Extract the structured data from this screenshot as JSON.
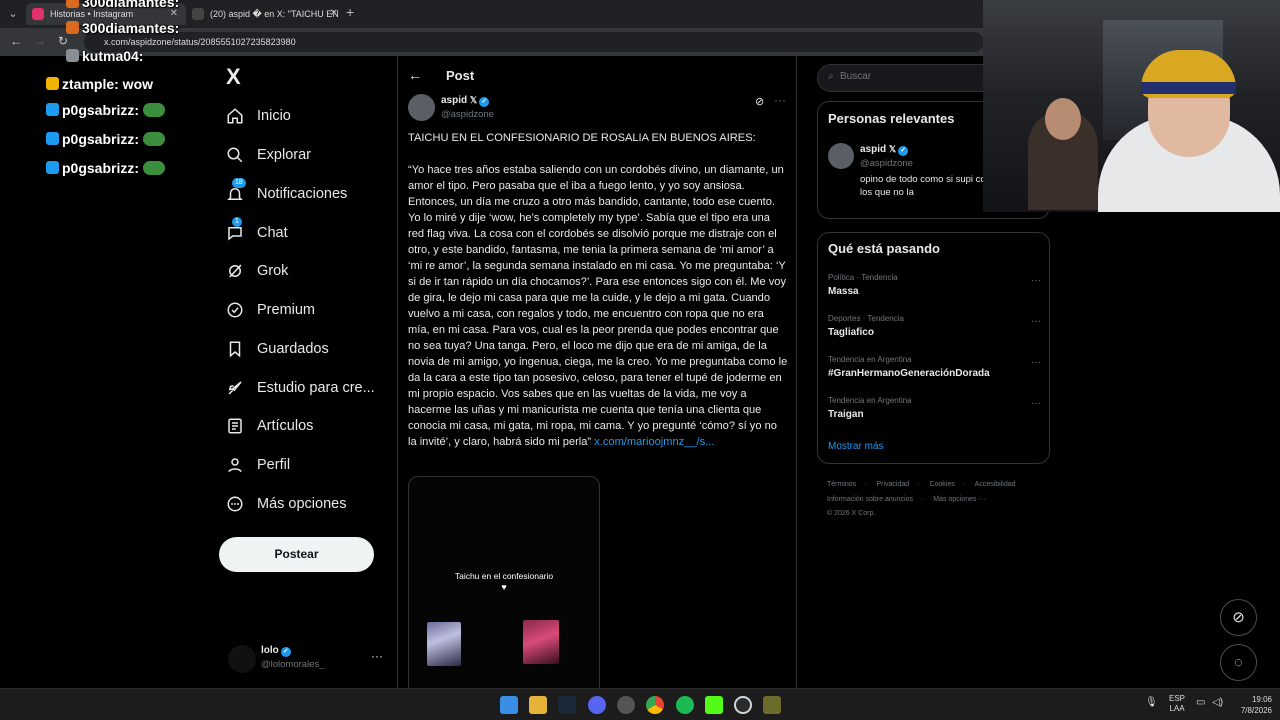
{
  "browser": {
    "tabs": [
      {
        "title": "Historias • Instagram",
        "color": "#e1306c"
      },
      {
        "title": "(20) aspid � en X: \"TAICHU EN",
        "color": "#000000"
      }
    ],
    "url": "x.com/aspidzone/status/2085551027235823980"
  },
  "stream_chat": [
    {
      "text": "300diamantes:",
      "badge": "#d96b1f",
      "emote": false
    },
    {
      "text": "kutma04:",
      "badge": "#8a8f95",
      "emote": false
    },
    {
      "text": "ztample: wow",
      "badge": "#f0b400",
      "emote": false
    },
    {
      "text": "p0gsabrizz:",
      "badge": "#1d9bf0",
      "emote": true
    },
    {
      "text": "p0gsabrizz:",
      "badge": "#1d9bf0",
      "emote": true
    },
    {
      "text": "p0gsabrizz:",
      "badge": "#1d9bf0",
      "emote": true
    }
  ],
  "nav": {
    "logo": "X",
    "items": [
      {
        "label": "Inicio",
        "icon": "home-icon"
      },
      {
        "label": "Explorar",
        "icon": "search-icon"
      },
      {
        "label": "Notificaciones",
        "icon": "bell-icon",
        "badge": "18"
      },
      {
        "label": "Chat",
        "icon": "chat-icon",
        "badge": "1"
      },
      {
        "label": "Grok",
        "icon": "grok-icon"
      },
      {
        "label": "Premium",
        "icon": "premium-icon"
      },
      {
        "label": "Guardados",
        "icon": "bookmark-icon"
      },
      {
        "label": "Estudio para cre...",
        "icon": "rocket-icon"
      },
      {
        "label": "Artículos",
        "icon": "article-icon"
      },
      {
        "label": "Perfil",
        "icon": "person-icon"
      },
      {
        "label": "Más opciones",
        "icon": "more-circle-icon"
      }
    ],
    "post_button": "Postear",
    "account": {
      "name": "lolo",
      "handle": "@lolomorales_"
    }
  },
  "post": {
    "header": "Post",
    "author": {
      "name": "aspid",
      "handle": "@aspidzone"
    },
    "headline": "TAICHU EN EL CONFESIONARIO DE ROSALIA EN BUENOS AIRES:",
    "body": "“Yo hace tres años estaba saliendo con un cordobés divino, un diamante, un amor el tipo. Pero pasaba que el iba a fuego lento, y yo soy ansiosa. Entonces, un día me cruzo a otro más bandido, cantante, todo ese cuento. Yo lo miré y dije ‘wow, he’s completely my type’. Sabía que el tipo era una red flag viva. La cosa con el cordobés se disolvió porque me distraje con el otro, y este bandido, fantasma, me tenia la primera semana de ‘mi amor’ a ‘mi re amor’, la segunda semana instalado en mi casa. Yo me preguntaba: ‘Y si de ir tan rápido un día chocamos?’. Para ese entonces sigo con él. Me voy de gira, le dejo mi casa para que me la cuide, y le dejo a mi gata. Cuando vuelvo a mi casa, con regalos y todo, me encuentro con ropa que no era mía, en mi casa. Para vos, cual es la peor prenda que podes encontrar que no sea tuya? Una tanga. Pero, el loco me dijo que era de mi amiga, de la novia de mi amigo, yo ingenua, ciega, me la creo. Yo me preguntaba como le da la cara a este tipo tan posesivo, celoso, para tener el tupé de joderme en mi propio espacio. Vos sabes que en las vueltas de la vida, me voy a hacerme las uñas y mi manicurista me cuenta  que tenía una clienta que conocia mi casa, mi gata, mi ropa, mi cama. Y yo pregunté ‘cómo? sí yo no la invité’, y claro, habrá sido mi perla” ",
    "link": "x.com/marioojmnz__/s...",
    "media": {
      "caption": "Taichu en el confesionario",
      "heart": "♥"
    }
  },
  "sidebar": {
    "search_placeholder": "Buscar",
    "relevant": {
      "title": "Personas relevantes",
      "name": "aspid",
      "handle": "@aspidzone",
      "bio": "opino de todo como si supi contexto para los que no la"
    },
    "trends": {
      "title": "Qué está pasando",
      "items": [
        {
          "context": "Política · Tendencia",
          "title": "Massa"
        },
        {
          "context": "Deportes · Tendencia",
          "title": "Tagliafico"
        },
        {
          "context": "Tendencia en Argentina",
          "title": "#GranHermanoGeneraciónDorada"
        },
        {
          "context": "Tendencia en Argentina",
          "title": "Traigan"
        }
      ],
      "show_more": "Mostrar más"
    },
    "footer": {
      "links": [
        "Términos",
        "Privacidad",
        "Cookies",
        "Accesibilidad",
        "Información sobre anuncios",
        "Más opciones ···"
      ],
      "copyright": "© 2026 X Corp."
    }
  },
  "taskbar": {
    "lang": "ESP",
    "lang2": "LAA",
    "time": "19:06",
    "date": "7/8/2026"
  }
}
